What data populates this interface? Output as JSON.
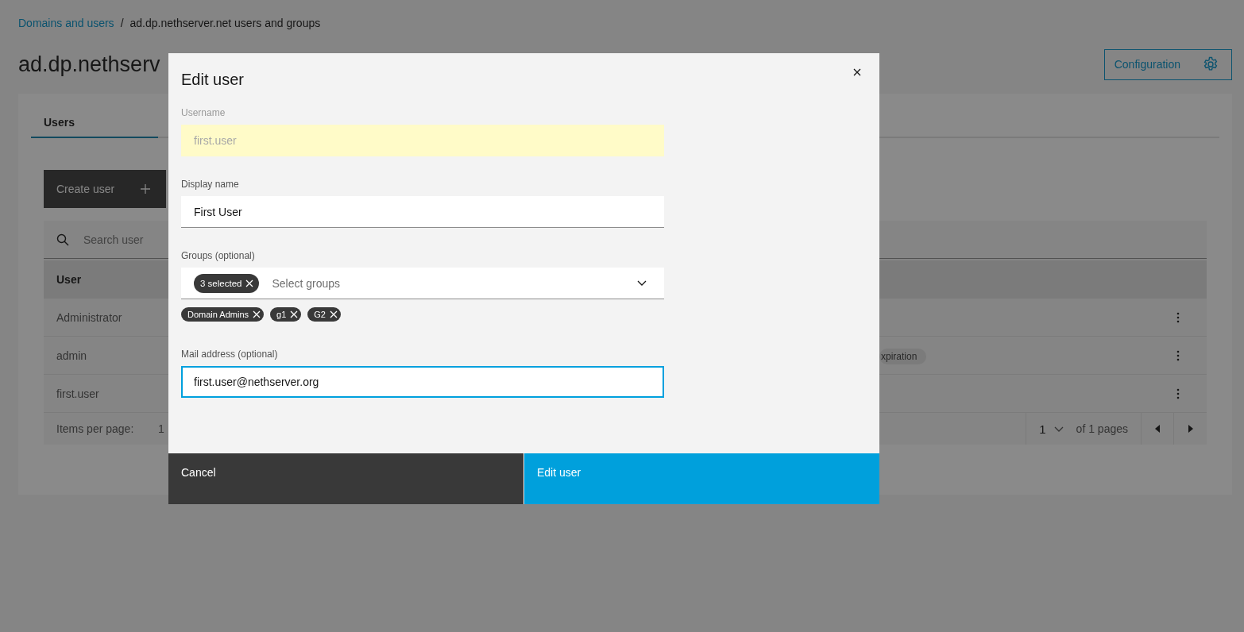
{
  "breadcrumb": [
    {
      "label": "Domains and users",
      "kind": "link"
    },
    {
      "label": "/",
      "kind": "separator"
    },
    {
      "label": "ad.dp.nethserver.net users and groups",
      "kind": "current"
    }
  ],
  "page_title": "ad.dp.nethserv",
  "config_button": "Configuration",
  "tabs": [
    {
      "label": "Users",
      "selected": true
    }
  ],
  "create_button": "Create user",
  "search": {
    "placeholder": "Search user"
  },
  "table": {
    "columns": [
      "User"
    ],
    "rows": [
      {
        "user": "Administrator"
      },
      {
        "user": "admin",
        "badge": "xpiration"
      },
      {
        "user": "first.user"
      }
    ]
  },
  "pagination": {
    "items_per_page_label": "Items per page:",
    "page_size": "1",
    "page": "1",
    "page_total": "of 1 pages"
  },
  "modal": {
    "title": "Edit user",
    "fields": [
      {
        "kind": "text",
        "label": "Username",
        "value": "first.user",
        "disabled": true,
        "autofilled": true,
        "focused": false
      },
      {
        "kind": "text",
        "label": "Display name",
        "value": "First User",
        "disabled": false,
        "autofilled": false,
        "focused": false
      },
      {
        "kind": "multiselect",
        "label": "Groups (optional)",
        "selected_count": "3 selected",
        "placeholder": "Select groups",
        "tags": [
          "Domain Admins",
          "g1",
          "G2"
        ],
        "disabled": false,
        "autofilled": false,
        "focused": false
      },
      {
        "kind": "text",
        "label": "Mail address (optional)",
        "value": "first.user@nethserver.org",
        "disabled": false,
        "autofilled": false,
        "focused": true
      }
    ],
    "buttons": [
      {
        "label": "Cancel",
        "kind": "secondary"
      },
      {
        "label": "Edit user",
        "kind": "primary"
      }
    ]
  }
}
